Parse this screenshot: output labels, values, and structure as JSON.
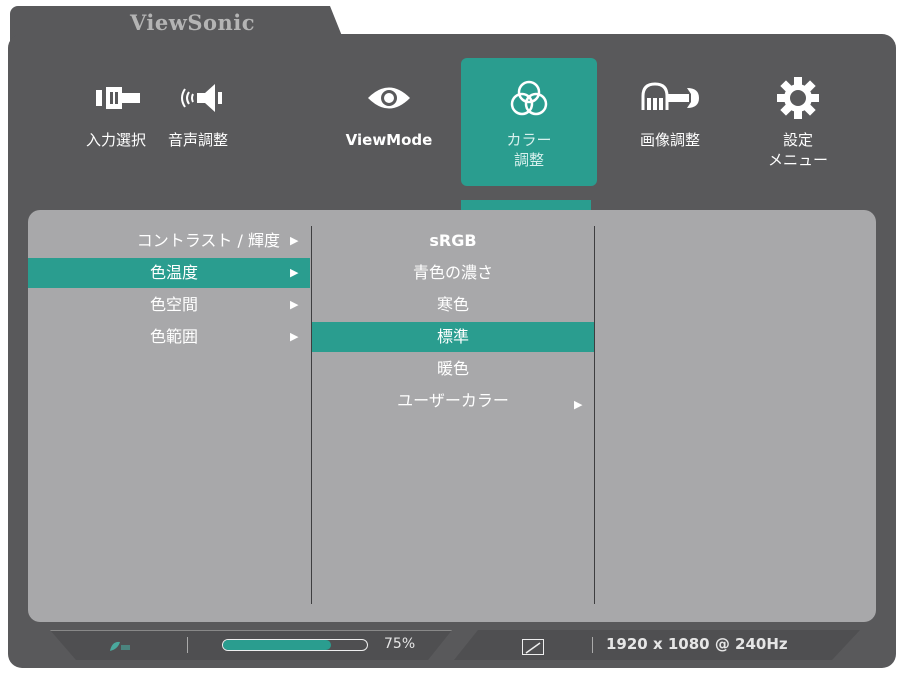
{
  "brand": "ViewSonic",
  "colors": {
    "frame": "#59595b",
    "panel": "#a8a8aa",
    "accent": "#2a9d8f"
  },
  "top_menu": [
    {
      "label": "入力選択",
      "icon": "input-select-icon"
    },
    {
      "label": "音声調整",
      "icon": "audio-icon"
    },
    {
      "label": "ViewMode",
      "icon": "eye-icon"
    },
    {
      "label": "カラー\n調整",
      "icon": "color-circles-icon",
      "active": true
    },
    {
      "label": "画像調整",
      "icon": "image-adjust-icon"
    },
    {
      "label": "設定\nメニュー",
      "icon": "gear-icon"
    }
  ],
  "submenu": [
    {
      "label": "コントラスト / 輝度",
      "arrow": "▶"
    },
    {
      "label": "色温度",
      "arrow": "▶",
      "selected": true
    },
    {
      "label": "色空間",
      "arrow": "▶"
    },
    {
      "label": "色範囲",
      "arrow": "▶"
    }
  ],
  "options": [
    {
      "label": "sRGB",
      "bold": true
    },
    {
      "label": "青色の濃さ"
    },
    {
      "label": "寒色"
    },
    {
      "label": "標準",
      "selected": true
    },
    {
      "label": "暖色"
    },
    {
      "label": "ユーザーカラー",
      "arrow": "▶"
    }
  ],
  "status": {
    "eco_icon": "eco-icon",
    "progress_fraction": 0.75,
    "progress_text": "75%",
    "aspect_icon": "aspect-ratio-icon",
    "resolution": "1920 x 1080 @ 240Hz"
  }
}
